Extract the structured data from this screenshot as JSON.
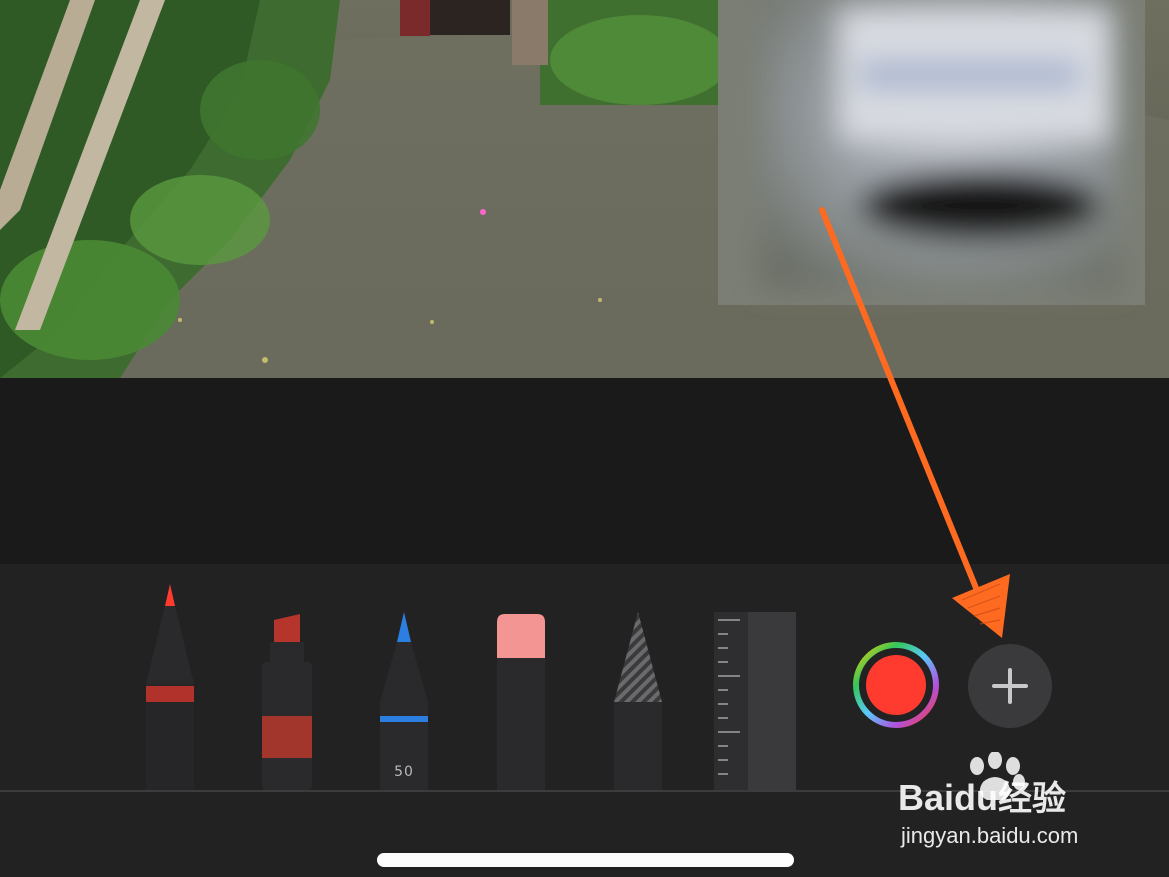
{
  "canvas": {
    "photo": "garden path photo with blurred overlay",
    "colors": {
      "sky_foliage": "#4f7a3a",
      "path": "#6b6b5c",
      "blur": "#b8bcc3"
    }
  },
  "toolbar": {
    "tools": [
      {
        "name": "pen",
        "accent": "#ff3b30"
      },
      {
        "name": "marker",
        "accent": "#b5342b"
      },
      {
        "name": "pencil",
        "accent": "#2c7fe0",
        "width_label": "50"
      },
      {
        "name": "eraser",
        "accent": "#f29593"
      },
      {
        "name": "lasso",
        "accent": "#5d5d5f"
      },
      {
        "name": "ruler",
        "accent": "#2c2c2e"
      }
    ],
    "current_color": "#ff3b30",
    "add_icon": "plus-icon"
  },
  "watermark": {
    "brand": "Baidu",
    "product": "经验",
    "url": "jingyan.baidu.com"
  },
  "annotation": {
    "color": "#ff6a21"
  }
}
